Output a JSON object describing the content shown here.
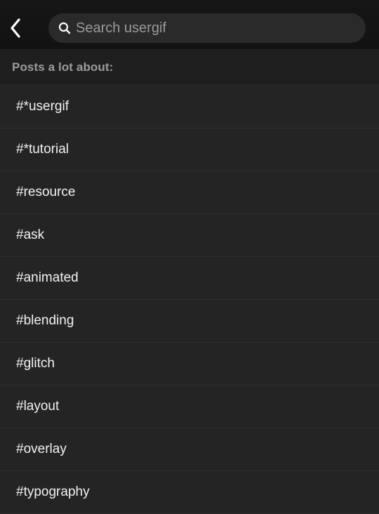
{
  "header": {
    "back_icon": "chevron-left-icon",
    "search": {
      "icon": "search-icon",
      "value": "",
      "placeholder": "Search usergif"
    }
  },
  "section": {
    "title": "Posts a lot about:"
  },
  "tags": [
    {
      "label": "#*usergif"
    },
    {
      "label": "#*tutorial"
    },
    {
      "label": "#resource"
    },
    {
      "label": "#ask"
    },
    {
      "label": "#animated"
    },
    {
      "label": "#blending"
    },
    {
      "label": "#glitch"
    },
    {
      "label": "#layout"
    },
    {
      "label": "#overlay"
    },
    {
      "label": "#typography"
    }
  ]
}
